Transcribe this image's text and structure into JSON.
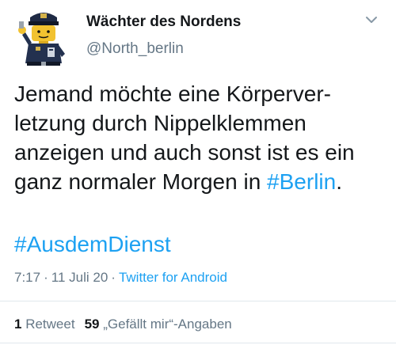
{
  "author": {
    "name": "Wächter des Nordens",
    "handle": "@North_berlin",
    "avatar_icon": "lego-police-officer-avatar"
  },
  "tweet": {
    "lines": [
      "Jemand möchte eine Körperver-",
      "letzung durch Nippelklemmen",
      "anzeigen und auch sonst ist es ein",
      "ganz normaler Morgen in "
    ],
    "inline_hashtag": "#Berlin",
    "end_punctuation": ".",
    "hashtag_line": "#AusdemDienst"
  },
  "meta": {
    "time": "7:17",
    "separator": "·",
    "date": "11 Juli 20",
    "source": "Twitter for Android"
  },
  "stats": {
    "retweet_count": "1",
    "retweet_label": "Retweet",
    "likes_count": "59",
    "likes_label": "„Gefällt mir“-Angaben"
  },
  "colors": {
    "link": "#1da1f2",
    "text": "#14171a",
    "secondary": "#657786",
    "divider": "#e1e8ed"
  },
  "icons": {
    "menu": "chevron-down-icon"
  }
}
